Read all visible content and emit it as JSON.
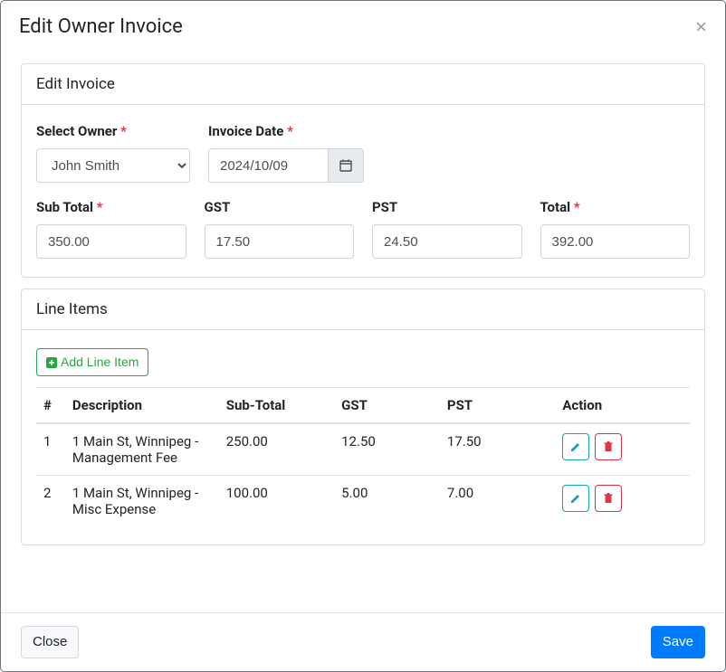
{
  "modal": {
    "title": "Edit Owner Invoice"
  },
  "editInvoice": {
    "panelTitle": "Edit Invoice",
    "selectOwner": {
      "label": "Select Owner",
      "value": "John Smith"
    },
    "invoiceDate": {
      "label": "Invoice Date",
      "value": "2024/10/09"
    },
    "subTotal": {
      "label": "Sub Total",
      "value": "350.00"
    },
    "gst": {
      "label": "GST",
      "value": "17.50"
    },
    "pst": {
      "label": "PST",
      "value": "24.50"
    },
    "total": {
      "label": "Total",
      "value": "392.00"
    }
  },
  "lineItems": {
    "panelTitle": "Line Items",
    "addButton": "Add Line Item",
    "columns": {
      "num": "#",
      "desc": "Description",
      "sub": "Sub-Total",
      "gst": "GST",
      "pst": "PST",
      "action": "Action"
    },
    "rows": [
      {
        "num": "1",
        "desc": "1 Main St, Winnipeg - Management Fee",
        "sub": "250.00",
        "gst": "12.50",
        "pst": "17.50"
      },
      {
        "num": "2",
        "desc": "1 Main St, Winnipeg - Misc Expense",
        "sub": "100.00",
        "gst": "5.00",
        "pst": "7.00"
      }
    ]
  },
  "footer": {
    "close": "Close",
    "save": "Save"
  }
}
